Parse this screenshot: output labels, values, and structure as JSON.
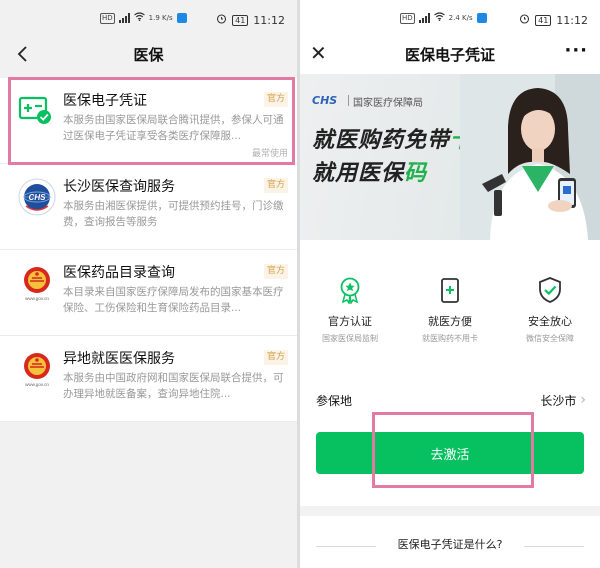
{
  "status_left": {
    "speed": "1.9 K/s",
    "time": "11:12",
    "battery": "41"
  },
  "status_right": {
    "speed": "2.4 K/s",
    "time": "11:12",
    "battery": "41"
  },
  "left": {
    "nav_title": "医保",
    "items": [
      {
        "title": "医保电子凭证",
        "desc": "本服务由国家医保局联合腾讯提供，参保人可通过医保电子凭证享受各类医疗保障服...",
        "badge": "官方",
        "meta": "最常使用",
        "icon": "medical-card-icon"
      },
      {
        "title": "长沙医保查询服务",
        "desc": "本服务由湘医保提供，可提供预约挂号，门诊缴费，查询报告等服务",
        "badge": "官方",
        "icon": "chs-globe-logo-icon"
      },
      {
        "title": "医保药品目录查询",
        "desc": "本目录来自国家医疗保障局发布的国家基本医疗保险、工伤保险和生育保险药品目录...",
        "badge": "官方",
        "icon": "national-emblem-icon"
      },
      {
        "title": "异地就医医保服务",
        "desc": "本服务由中国政府网和国家医保局联合提供，可办理异地就医备案，查询异地住院...",
        "badge": "官方",
        "icon": "national-emblem-icon"
      }
    ]
  },
  "right": {
    "nav_title": "医保电子凭证",
    "more": "···",
    "banner": {
      "logo": "CHS",
      "org": "国家医疗保障局",
      "slogan1_a": "就医购药免带",
      "slogan1_b": "卡",
      "slogan2_a": "就用医保",
      "slogan2_b": "码"
    },
    "features": [
      {
        "title": "官方认证",
        "sub": "国家医保局监制",
        "icon": "ribbon-star-icon"
      },
      {
        "title": "就医方便",
        "sub": "就医购药不用卡",
        "icon": "phone-plus-icon"
      },
      {
        "title": "安全放心",
        "sub": "微信安全保障",
        "icon": "shield-check-icon"
      }
    ],
    "insure_label": "参保地",
    "insure_value": "长沙市",
    "activate": "去激活",
    "whatis": "医保电子凭证是什么?"
  },
  "colors": {
    "wechat_green": "#07c160",
    "highlight_pink": "#e27aa3",
    "badge_gold": "#d4a04d"
  }
}
